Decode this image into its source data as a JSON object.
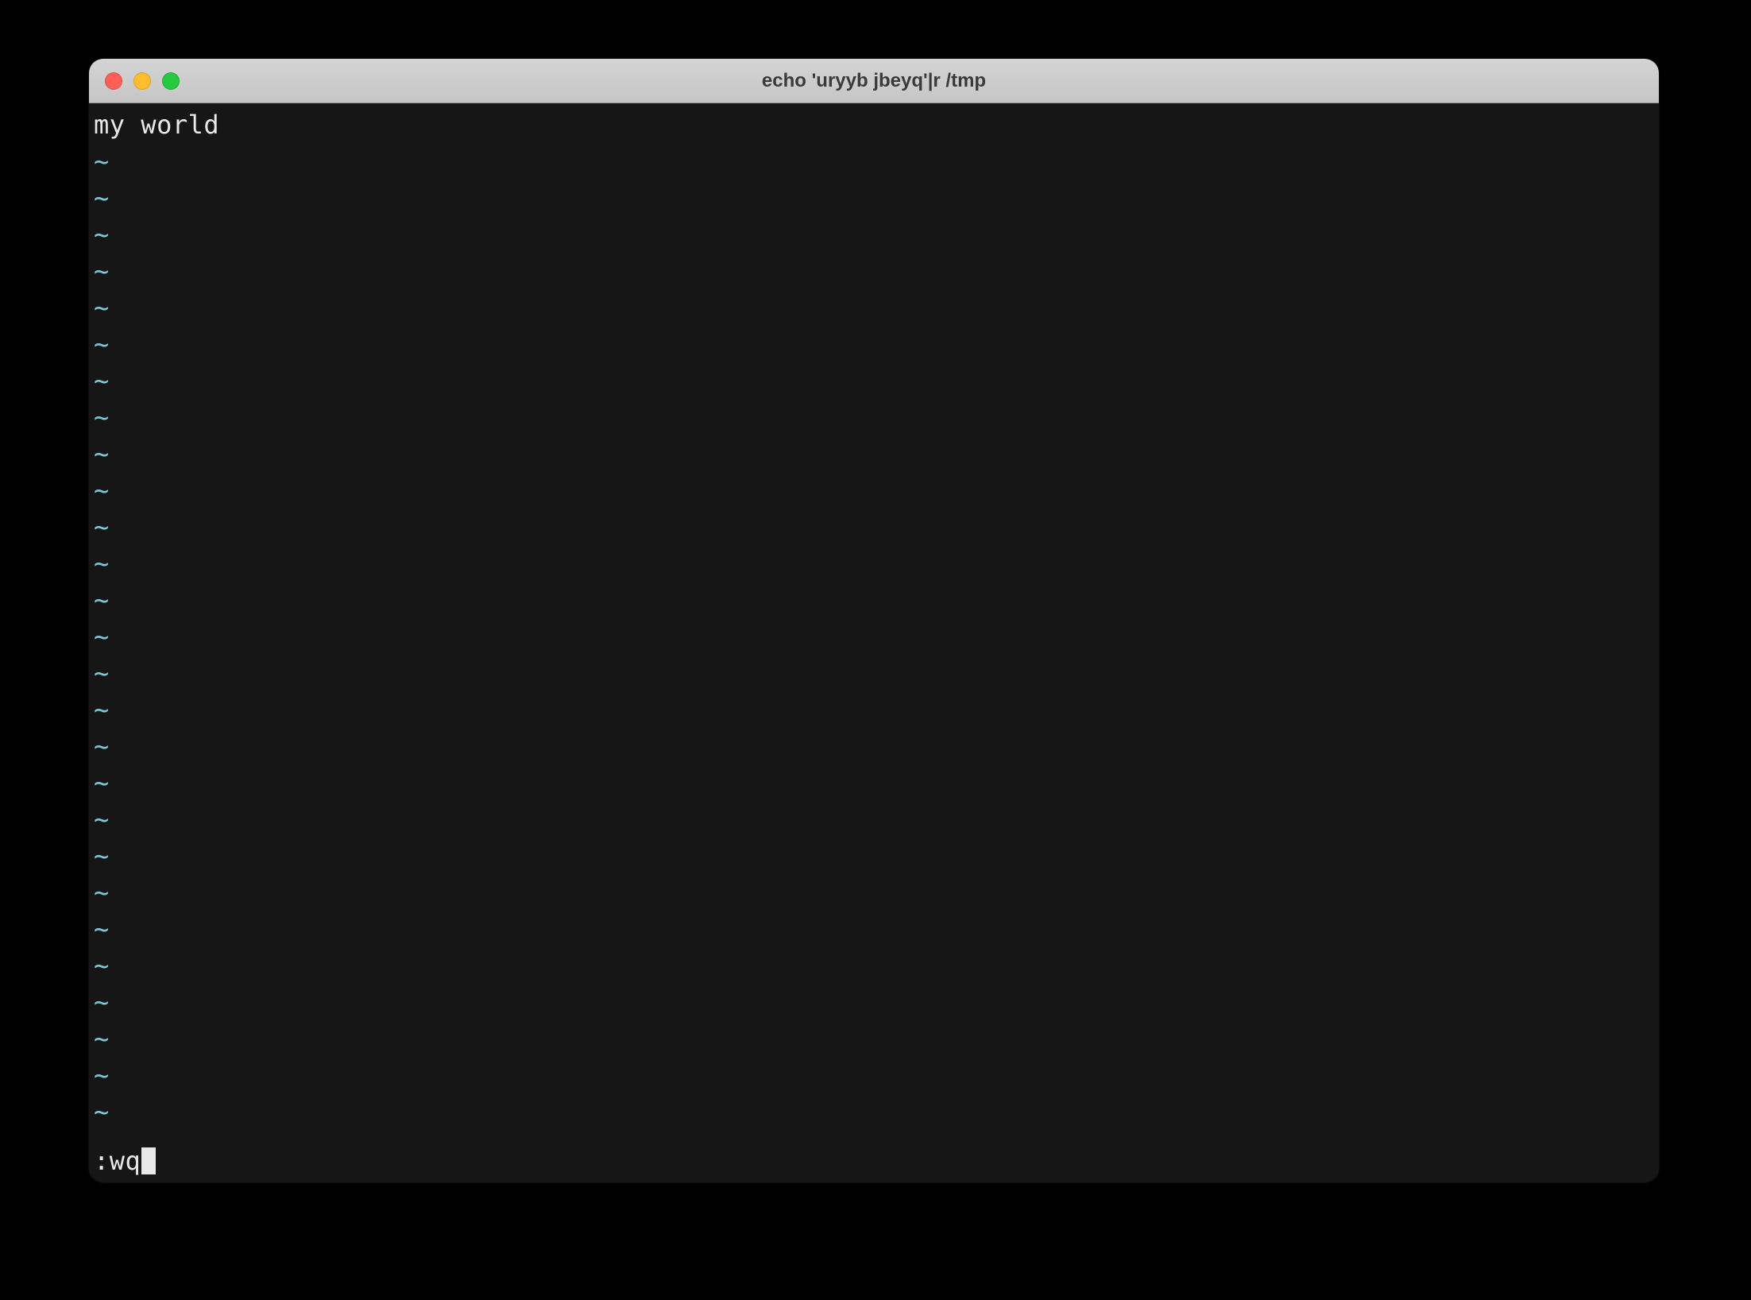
{
  "window": {
    "title": "echo 'uryyb jbeyq'|r /tmp"
  },
  "editor": {
    "content_line": "my world",
    "tilde_char": "~",
    "tilde_count": 27,
    "command": ":wq"
  },
  "colors": {
    "tilde": "#7ec9d8",
    "text": "#e8e8e8",
    "bg": "#161616"
  }
}
